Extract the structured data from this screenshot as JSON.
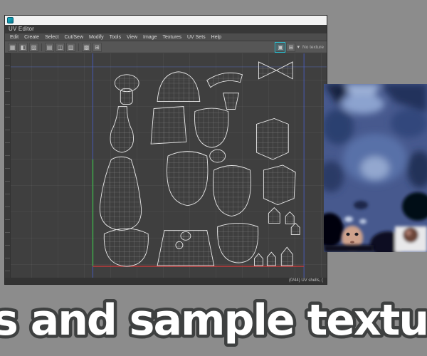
{
  "window": {
    "title": "UV Editor",
    "menus": [
      "Edit",
      "Create",
      "Select",
      "Cut/Sew",
      "Modify",
      "Tools",
      "View",
      "Image",
      "Textures",
      "UV Sets",
      "Help"
    ],
    "toolbar": {
      "items": [
        {
          "name": "uv-lattice-icon",
          "glyph": "▦"
        },
        {
          "name": "move-uv-icon",
          "glyph": "◧"
        },
        {
          "name": "sew-uv-icon",
          "glyph": "▨"
        },
        {
          "name": "grab-uv-icon",
          "glyph": "▤"
        },
        {
          "name": "pinch-uv-icon",
          "glyph": "◫"
        },
        {
          "name": "smear-uv-icon",
          "glyph": "▥"
        },
        {
          "name": "checker-display-icon",
          "glyph": "▩"
        },
        {
          "name": "texture-borders-icon",
          "glyph": "⊞"
        }
      ],
      "right": {
        "active_glyph": "▣",
        "grid_glyph": "⊞",
        "caret": "▾",
        "label": "No texture"
      }
    },
    "status_right": "(0/44) UV shells, (",
    "axes": {
      "u_axis_color": "#c23b3b",
      "v_axis_color": "#3fae4a",
      "uv_border_color": "#4a63d8"
    }
  },
  "caption": "UVs and sample textures",
  "colors": {
    "page_background": "#8c8c8c",
    "viewport_background": "#3f3f3f",
    "accent_teal": "#2ec4d6",
    "caption_fill": "#ffffff",
    "caption_outline": "#3e4040"
  }
}
